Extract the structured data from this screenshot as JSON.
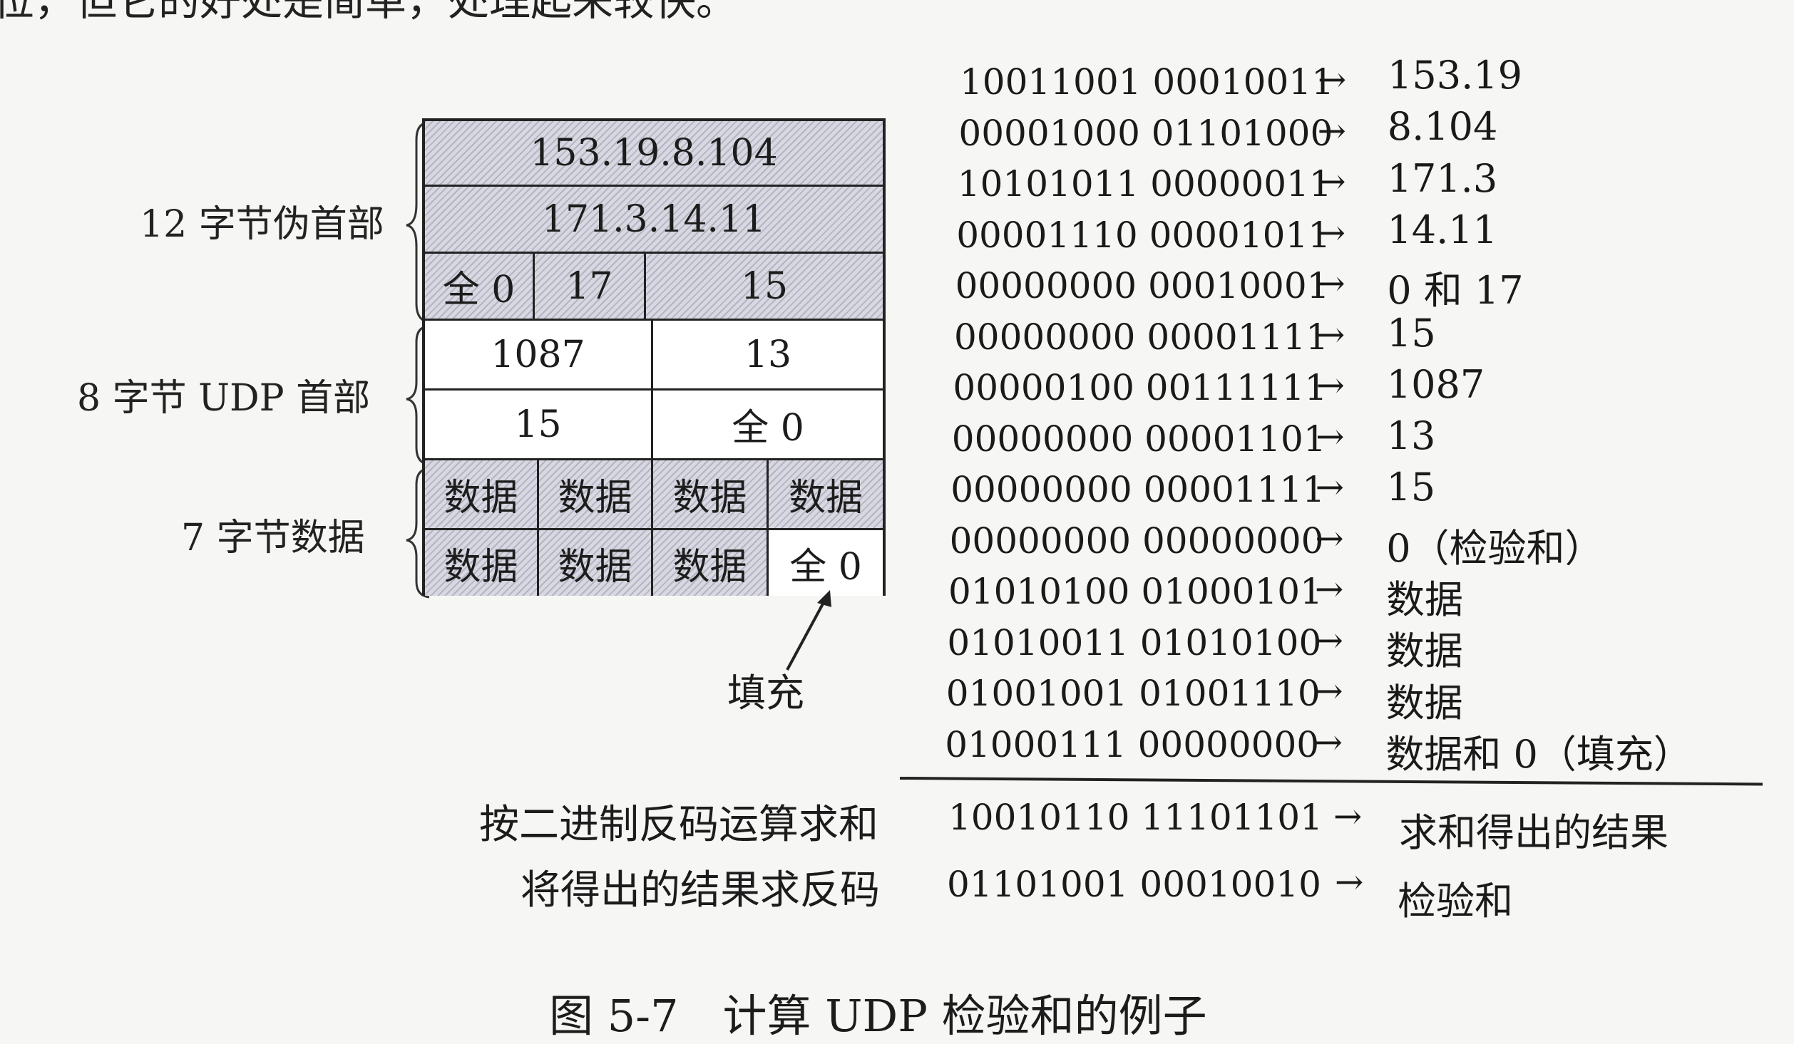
{
  "top_text": "位，但它的好处是简单，处理起来较快。",
  "diagram": {
    "labels": {
      "pseudo_header": "12 字节伪首部",
      "udp_header": "8 字节 UDP 首部",
      "data": "7 字节数据",
      "padding": "填充"
    },
    "rows": [
      [
        "153.19.8.104"
      ],
      [
        "171.3.14.11"
      ],
      [
        "全 0",
        "17",
        "15"
      ],
      [
        "1087",
        "13"
      ],
      [
        "15",
        "全 0"
      ],
      [
        "数据",
        "数据",
        "数据",
        "数据"
      ],
      [
        "数据",
        "数据",
        "数据",
        "全 0"
      ]
    ]
  },
  "checksum_lines": [
    {
      "bin": "10011001 00010011",
      "arrow": "→",
      "value": "153.19"
    },
    {
      "bin": "00001000 01101000",
      "arrow": "→",
      "value": "8.104"
    },
    {
      "bin": "10101011 00000011",
      "arrow": "→",
      "value": "171.3"
    },
    {
      "bin": "00001110 00001011",
      "arrow": "→",
      "value": "14.11"
    },
    {
      "bin": "00000000 00010001",
      "arrow": "→",
      "value": "0 和 17"
    },
    {
      "bin": "00000000 00001111",
      "arrow": "→",
      "value": "15"
    },
    {
      "bin": "00000100 00111111",
      "arrow": "→",
      "value": "1087"
    },
    {
      "bin": "00000000 00001101",
      "arrow": "→",
      "value": "13"
    },
    {
      "bin": "00000000 00001111",
      "arrow": "→",
      "value": "15"
    },
    {
      "bin": "00000000 00000000",
      "arrow": "→",
      "value": "0（检验和）"
    },
    {
      "bin": "01010100 01000101",
      "arrow": "→",
      "value": "数据"
    },
    {
      "bin": "01010011 01010100",
      "arrow": "→",
      "value": "数据"
    },
    {
      "bin": "01001001 01001110",
      "arrow": "→",
      "value": "数据"
    },
    {
      "bin": "01000111 00000000",
      "arrow": "→",
      "value": "数据和 0（填充）"
    }
  ],
  "results": [
    {
      "label": "按二进制反码运算求和",
      "bin": "10010110 11101101",
      "arrow": "→",
      "value": "求和得出的结果"
    },
    {
      "label": "将得出的结果求反码",
      "bin": "01101001 00010010",
      "arrow": "→",
      "value": "检验和"
    }
  ],
  "caption": "图 5-7　计算 UDP 检验和的例子"
}
